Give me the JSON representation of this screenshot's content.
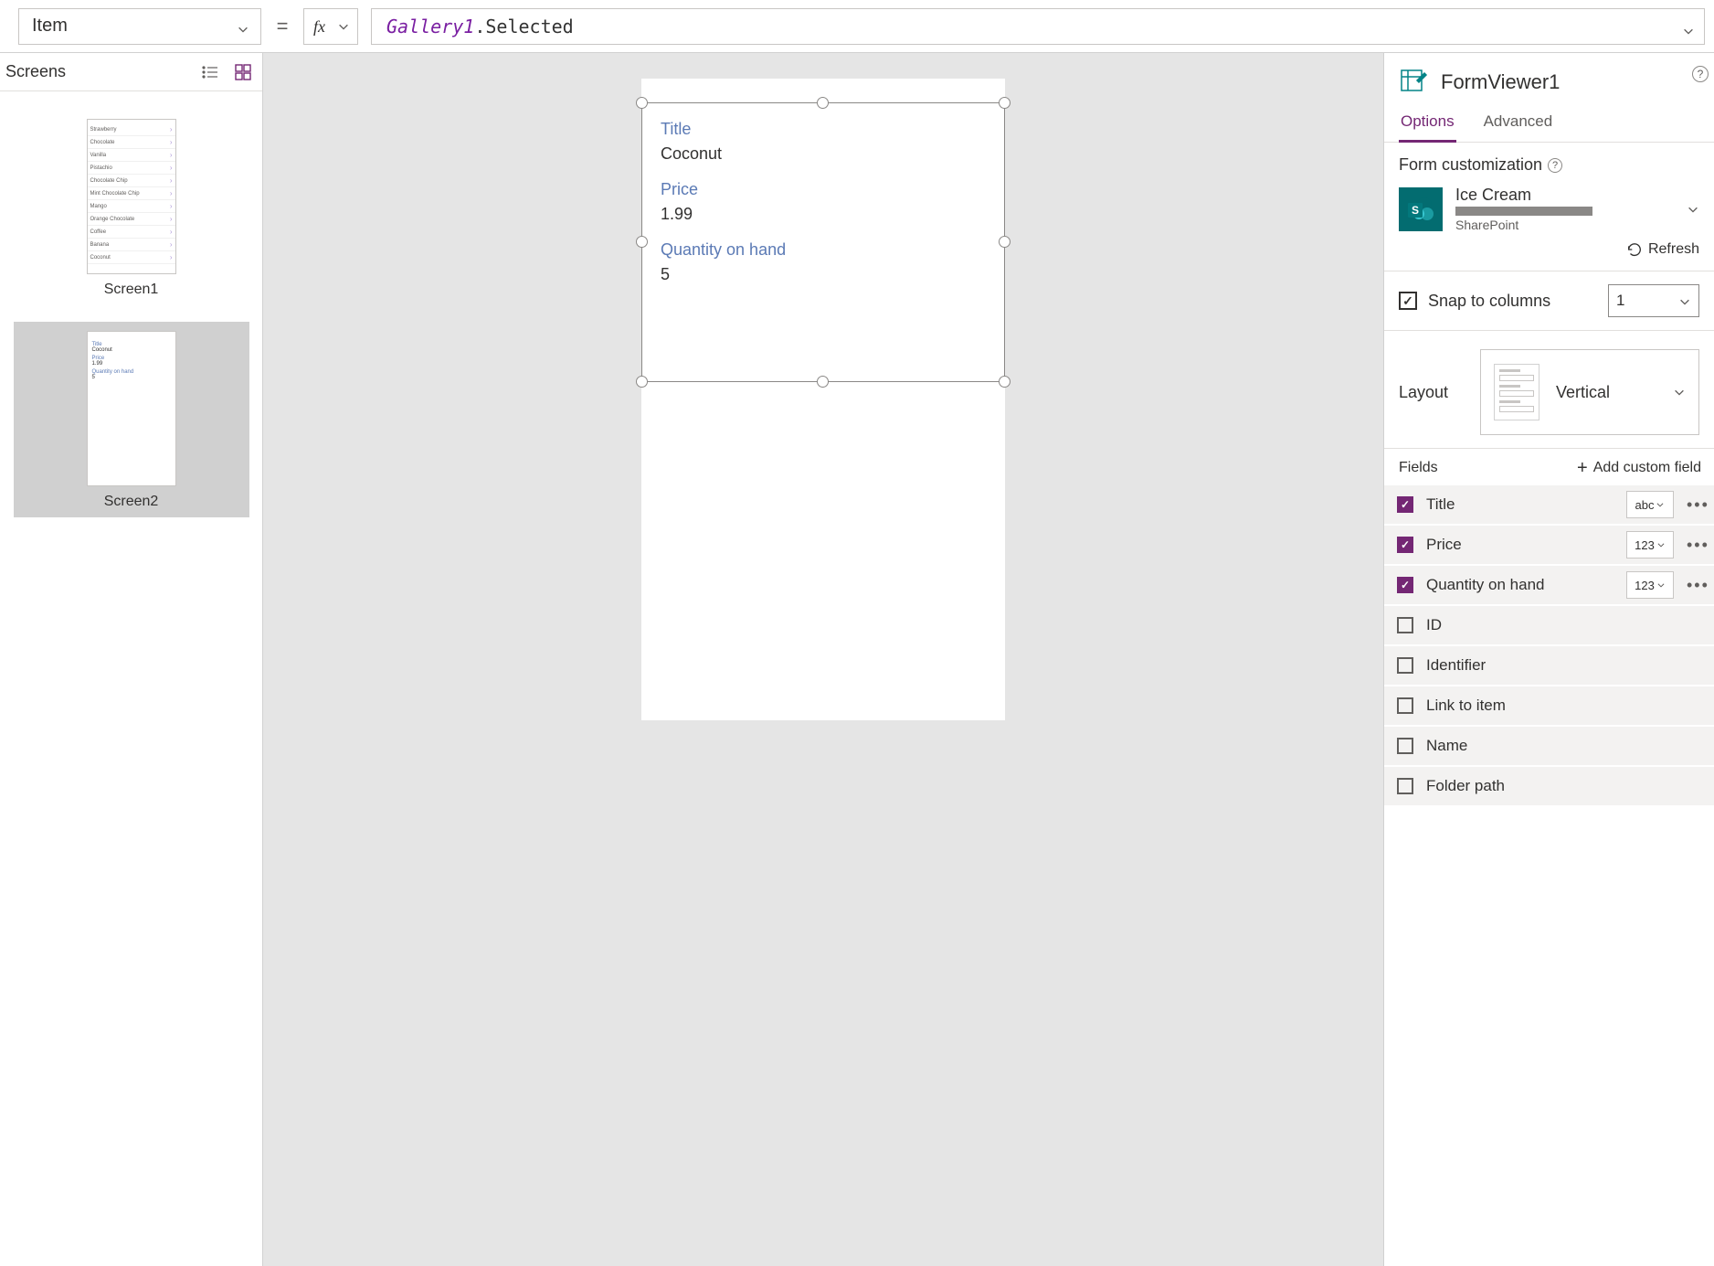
{
  "property_dropdown": "Item",
  "formula": {
    "token": "Gallery1",
    "suffix": ".Selected"
  },
  "left_panel": {
    "title": "Screens",
    "screens": [
      {
        "name": "Screen1",
        "selected": false,
        "type": "list",
        "rows": [
          "Strawberry",
          "Chocolate",
          "Vanilla",
          "Pistachio",
          "Chocolate Chip",
          "Mint Chocolate Chip",
          "Mango",
          "Orange Chocolate",
          "Coffee",
          "Banana",
          "Coconut"
        ]
      },
      {
        "name": "Screen2",
        "selected": true,
        "type": "form",
        "mini": [
          {
            "l": "Title",
            "v": "Coconut"
          },
          {
            "l": "Price",
            "v": "1.99"
          },
          {
            "l": "Quantity on hand",
            "v": "5"
          }
        ]
      }
    ]
  },
  "canvas": {
    "fields": [
      {
        "label": "Title",
        "value": "Coconut"
      },
      {
        "label": "Price",
        "value": "1.99"
      },
      {
        "label": "Quantity on hand",
        "value": "5"
      }
    ]
  },
  "right_panel": {
    "control_name": "FormViewer1",
    "tabs": {
      "options": "Options",
      "advanced": "Advanced"
    },
    "form_customization": "Form customization",
    "datasource": {
      "name": "Ice Cream",
      "type": "SharePoint"
    },
    "refresh": "Refresh",
    "snap_label": "Snap to columns",
    "snap_columns": "1",
    "layout_label": "Layout",
    "layout_value": "Vertical",
    "fields_label": "Fields",
    "add_custom": "Add custom field",
    "fields": [
      {
        "name": "Title",
        "on": true,
        "type": "abc"
      },
      {
        "name": "Price",
        "on": true,
        "type": "123"
      },
      {
        "name": "Quantity on hand",
        "on": true,
        "type": "123"
      },
      {
        "name": "ID",
        "on": false
      },
      {
        "name": "Identifier",
        "on": false
      },
      {
        "name": "Link to item",
        "on": false
      },
      {
        "name": "Name",
        "on": false
      },
      {
        "name": "Folder path",
        "on": false
      }
    ]
  }
}
